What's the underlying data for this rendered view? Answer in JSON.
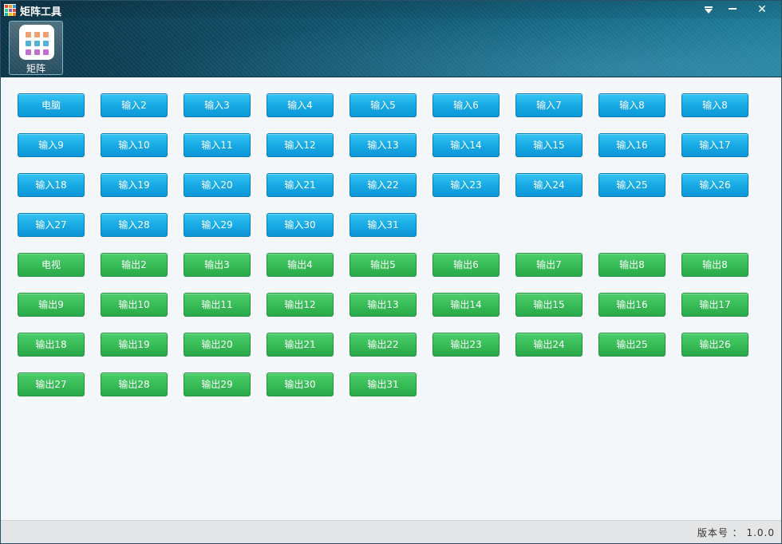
{
  "window": {
    "title": "矩阵工具"
  },
  "toolbar": {
    "tool_label": "矩阵"
  },
  "inputs": [
    "电脑",
    "输入2",
    "输入3",
    "输入4",
    "输入5",
    "输入6",
    "输入7",
    "输入8",
    "输入8",
    "输入9",
    "输入10",
    "输入11",
    "输入12",
    "输入13",
    "输入14",
    "输入15",
    "输入16",
    "输入17",
    "输入18",
    "输入19",
    "输入20",
    "输入21",
    "输入22",
    "输入23",
    "输入24",
    "输入25",
    "输入26",
    "输入27",
    "输入28",
    "输入29",
    "输入30",
    "输入31"
  ],
  "outputs": [
    "电视",
    "输出2",
    "输出3",
    "输出4",
    "输出5",
    "输出6",
    "输出7",
    "输出8",
    "输出8",
    "输出9",
    "输出10",
    "输出11",
    "输出12",
    "输出13",
    "输出14",
    "输出15",
    "输出16",
    "输出17",
    "输出18",
    "输出19",
    "输出20",
    "输出21",
    "输出22",
    "输出23",
    "输出24",
    "输出25",
    "输出26",
    "输出27",
    "输出28",
    "输出29",
    "输出30",
    "输出31"
  ],
  "status": {
    "version": "版本号 ： 1.0.0"
  },
  "colors": {
    "input_button": "#16a8e4",
    "output_button": "#36bb55",
    "header_dark": "#0b3447",
    "header_light": "#1b7a98",
    "content_bg": "#f3f7fa",
    "status_bg": "#e3e5e6"
  },
  "icons": {
    "app": "matrix-grid-icon",
    "tool": "matrix-grid-icon",
    "menu": "dropdown-menu-icon",
    "minimize": "minimize-icon",
    "close": "close-icon"
  }
}
